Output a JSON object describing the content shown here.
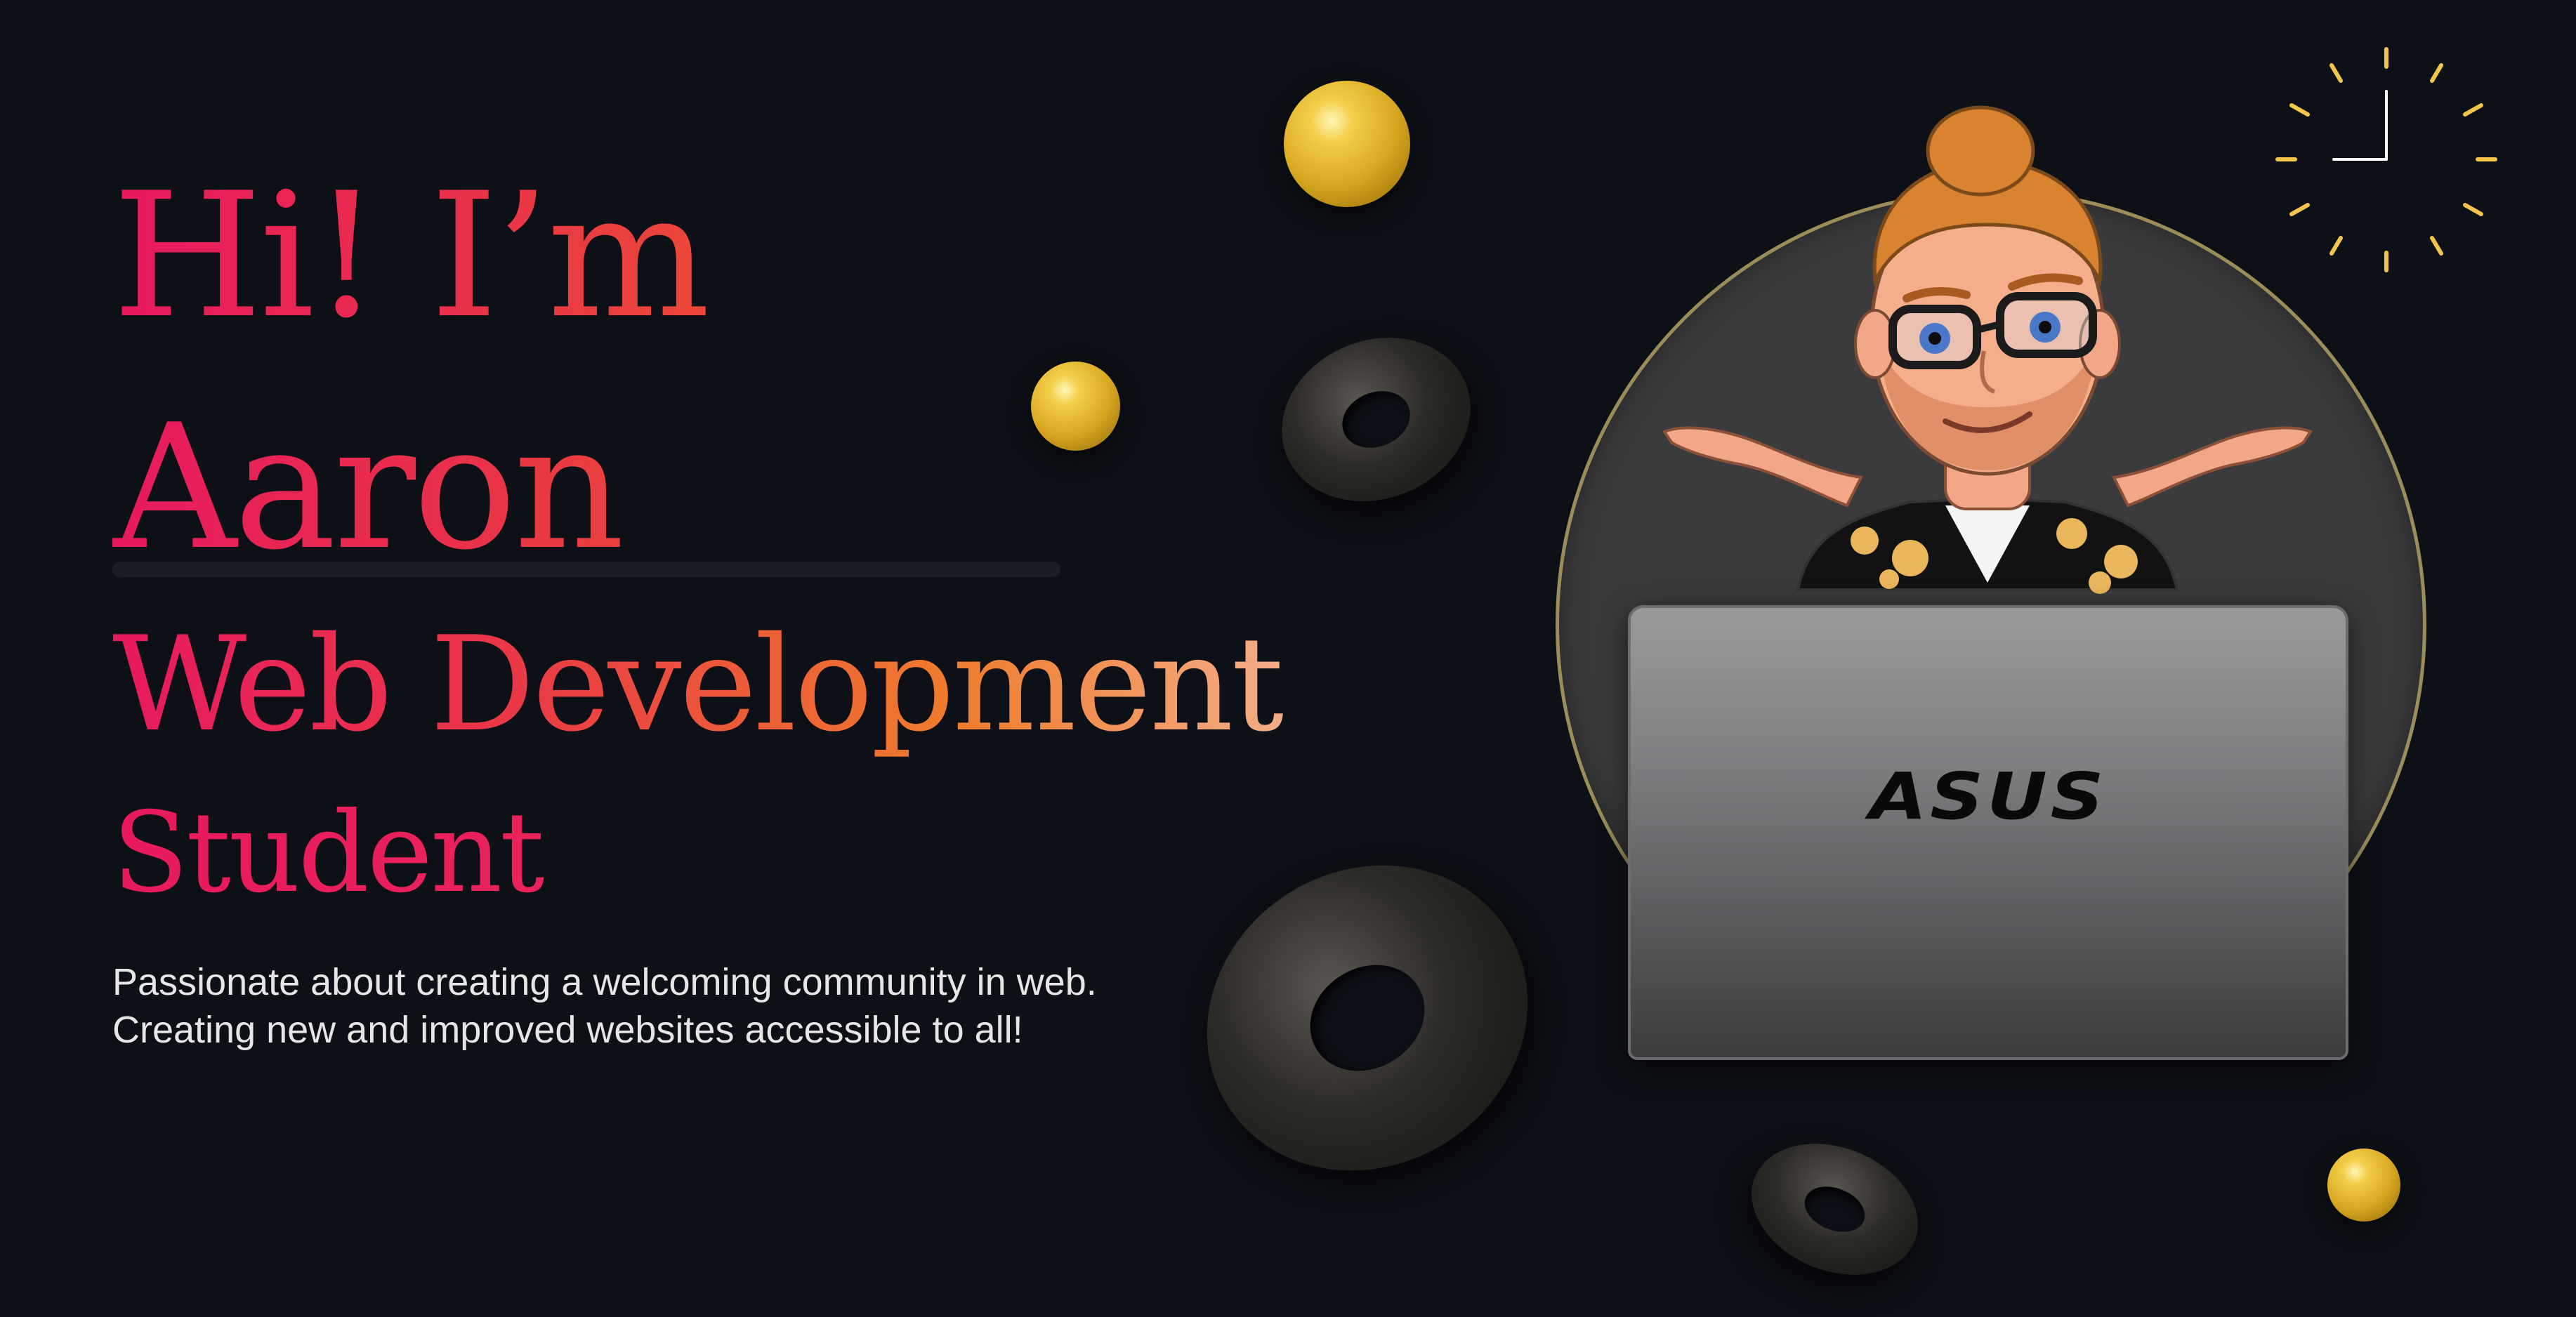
{
  "hero": {
    "greeting_line1": "Hi! I’m",
    "greeting_line2": "Aaron",
    "role_line1": "Web Development",
    "role_line2": "Student",
    "tagline_line1": "Passionate about creating a welcoming community in web.",
    "tagline_line2": "Creating new and improved websites accessible to all!"
  },
  "laptop": {
    "brand": "ASUS"
  },
  "colors": {
    "background": "#0d1016",
    "accent_pink": "#e81a5e",
    "accent_orange": "#ef7b2c",
    "accent_peach": "#f3b08c",
    "gold": "#f3cf4a",
    "tagline_text": "#e6e6e6"
  },
  "icons": [
    "clock-icon"
  ]
}
